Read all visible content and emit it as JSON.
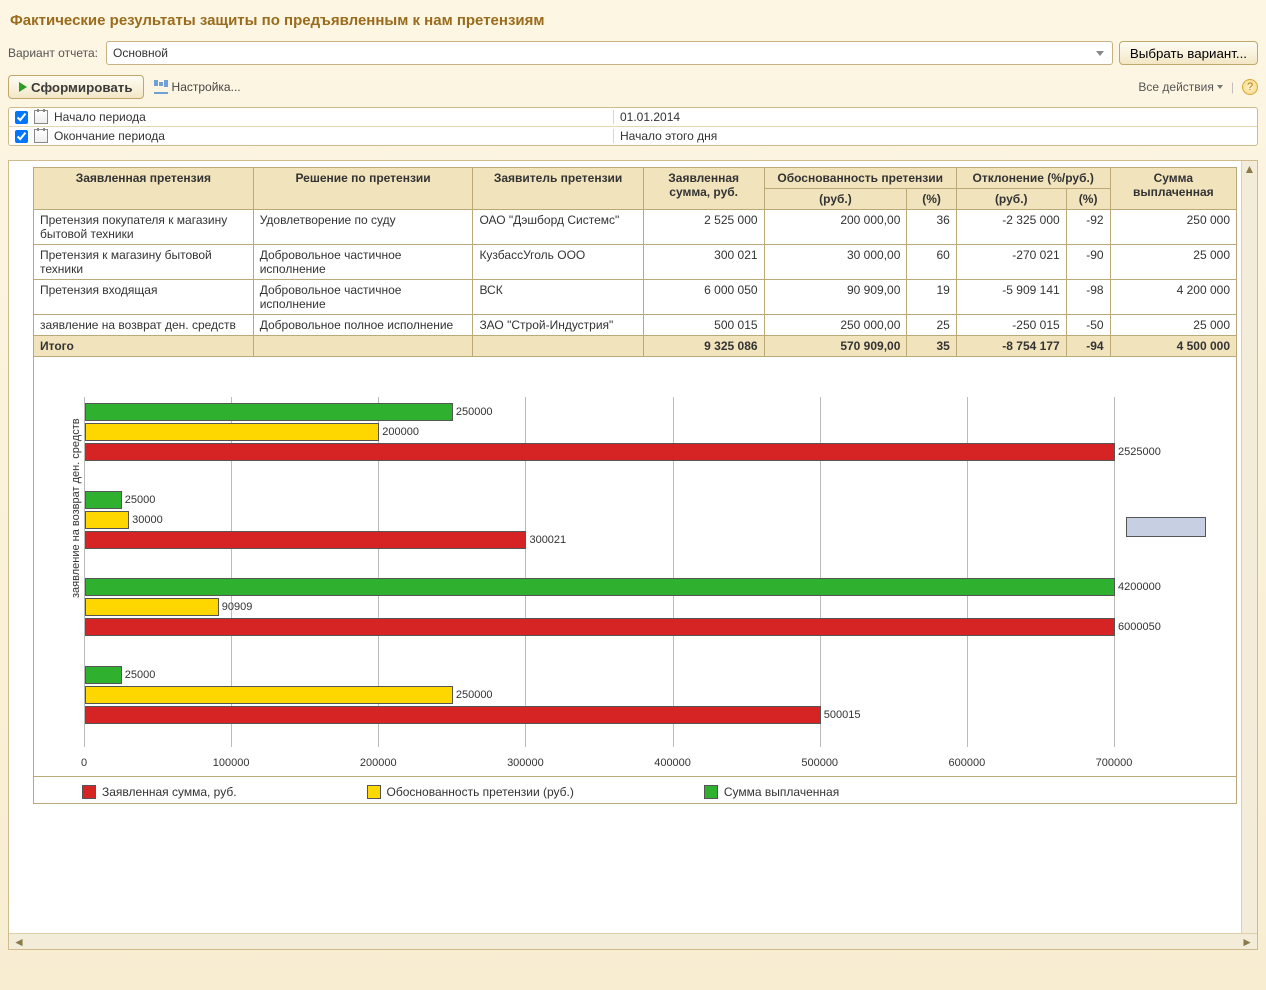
{
  "header": {
    "title": "Фактические результаты защиты по предъявленным  к нам претензиям"
  },
  "variant": {
    "label": "Вариант отчета:",
    "value": "Основной",
    "choose_btn": "Выбрать вариант..."
  },
  "toolbar": {
    "generate": "Сформировать",
    "settings": "Настройка...",
    "all_actions": "Все действия"
  },
  "period": {
    "start_label": "Начало периода",
    "start_value": "01.01.2014",
    "end_label": "Окончание периода",
    "end_value": "Начало этого дня"
  },
  "table": {
    "headers": {
      "claim": "Заявленная претензия",
      "decision": "Решение по претензии",
      "applicant": "Заявитель претензии",
      "amount": "Заявленная сумма, руб.",
      "validity": "Обоснованность претензии",
      "variance": "Отклонение (%/руб.)",
      "paid": "Сумма выплаченная",
      "rub": "(руб.)",
      "pct": "(%)"
    },
    "rows": [
      {
        "claim": "Претензия покупателя к магазину бытовой техники",
        "decision": "Удовлетворение по суду",
        "applicant": "ОАО \"Дэшборд Системс\"",
        "amount": "2 525 000",
        "v_rub": "200 000,00",
        "v_pct": "36",
        "d_rub": "-2 325 000",
        "d_pct": "-92",
        "paid": "250 000"
      },
      {
        "claim": "Претензия к магазину бытовой техники",
        "decision": "Добровольное частичное исполнение",
        "applicant": "КузбассУголь ООО",
        "amount": "300 021",
        "v_rub": "30 000,00",
        "v_pct": "60",
        "d_rub": "-270 021",
        "d_pct": "-90",
        "paid": "25 000"
      },
      {
        "claim": "Претензия входящая",
        "decision": "Добровольное частичное исполнение",
        "applicant": "ВСК",
        "amount": "6 000 050",
        "v_rub": "90 909,00",
        "v_pct": "19",
        "d_rub": "-5 909 141",
        "d_pct": "-98",
        "paid": "4 200 000"
      },
      {
        "claim": "заявление на возврат ден. средств",
        "decision": "Добровольное полное исполнение",
        "applicant": "ЗАО \"Строй-Индустрия\"",
        "amount": "500 015",
        "v_rub": "250 000,00",
        "v_pct": "25",
        "d_rub": "-250 015",
        "d_pct": "-50",
        "paid": "25 000"
      }
    ],
    "total": {
      "label": "Итого",
      "amount": "9 325 086",
      "v_rub": "570 909,00",
      "v_pct": "35",
      "d_rub": "-8 754 177",
      "d_pct": "-94",
      "paid": "4 500 000"
    }
  },
  "chart_data": {
    "type": "bar",
    "orientation": "horizontal",
    "xlabel": "",
    "ylabel": "заявление на возврат ден. средств",
    "xlim": [
      0,
      700000
    ],
    "xticks": [
      0,
      100000,
      200000,
      300000,
      400000,
      500000,
      600000,
      700000
    ],
    "series": [
      {
        "name": "Заявленная сумма, руб.",
        "color": "#d62424",
        "values": [
          2525000,
          300021,
          6000050,
          500015
        ]
      },
      {
        "name": "Обоснованность претензии (руб.)",
        "color": "#ffd700",
        "values": [
          200000,
          30000,
          90909,
          250000
        ]
      },
      {
        "name": "Сумма выплаченная",
        "color": "#2fb02f",
        "values": [
          250000,
          25000,
          4200000,
          25000
        ]
      }
    ],
    "categories": [
      "Претензия покупателя к магазину бытовой техники",
      "Претензия к магазину бытовой техники",
      "Претензия входящая",
      "заявление на возврат ден. средств"
    ]
  },
  "legend": {
    "s1": "Заявленная сумма, руб.",
    "s2": "Обоснованность претензии (руб.)",
    "s3": "Сумма выплаченная"
  }
}
